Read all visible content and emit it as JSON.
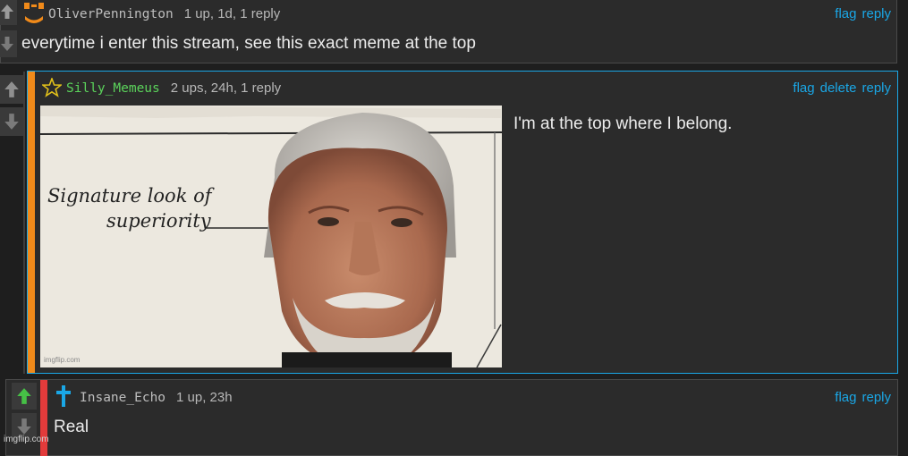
{
  "comments": [
    {
      "username": "OliverPennington",
      "stats": "1 up, 1d, 1 reply",
      "text": "everytime i enter this stream, see this exact meme at the top",
      "actions": [
        "flag",
        "reply"
      ],
      "upvote_color": "#9a9a9a",
      "avatar_color": "#f08a1a"
    },
    {
      "username": "Silly_Memeus",
      "stats": "2 ups, 24h, 1 reply",
      "text": "I'm at the top where I belong.",
      "actions": [
        "flag",
        "delete",
        "reply"
      ],
      "username_color": "#5bd35b",
      "bar_color": "#f08a1a",
      "border_color": "#1aa7e6",
      "meme": {
        "caption_line1": "Signature look of",
        "caption_line2": "superiority",
        "watermark": "imgflip.com"
      }
    },
    {
      "username": "Insane_Echo",
      "stats": "1 up, 23h",
      "text": "Real",
      "actions": [
        "flag",
        "reply"
      ],
      "upvote_color": "#46c046",
      "bar_color": "#e23b3b",
      "cross_color": "#1aa7e6"
    }
  ],
  "page_watermark": "imgflip.com"
}
